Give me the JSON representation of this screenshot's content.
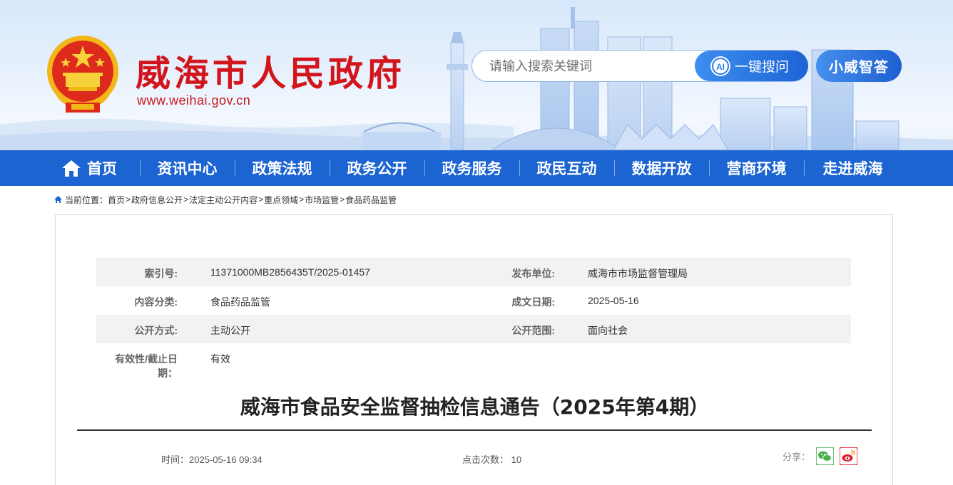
{
  "header": {
    "site_title": "威海市人民政府",
    "site_url": "www.weihai.gov.cn",
    "emblem_icon": "national-emblem-icon",
    "search": {
      "placeholder": "请输入搜索关键词"
    },
    "ai_button_label": "一键搜问",
    "ai_icon_text": "AI",
    "assistant_button_label": "小威智答"
  },
  "colors": {
    "brand_red": "#d2151c",
    "nav_blue": "#1c64d2",
    "accent_blue": "#3d8ef0"
  },
  "nav": {
    "items": [
      "首页",
      "资讯中心",
      "政策法规",
      "政务公开",
      "政务服务",
      "政民互动",
      "数据开放",
      "营商环境",
      "走进威海"
    ]
  },
  "breadcrumb": {
    "prefix": "当前位置：",
    "items": [
      "首页",
      "政府信息公开",
      "法定主动公开内容",
      "重点领域",
      "市场监管",
      "食品药品监管"
    ],
    "separator": ">"
  },
  "meta": {
    "index_label": "索引号:",
    "index_value": "11371000MB2856435T/2025-01457",
    "publisher_label": "发布单位:",
    "publisher_value": "威海市市场监督管理局",
    "category_label": "内容分类:",
    "category_value": "食品药品监管",
    "date_label": "成文日期:",
    "date_value": "2025-05-16",
    "method_label": "公开方式:",
    "method_value": "主动公开",
    "scope_label": "公开范围:",
    "scope_value": "面向社会",
    "validity_label": "有效性/截止日期：",
    "validity_value": "有效"
  },
  "article": {
    "title": "威海市食品安全监督抽检信息通告（2025年第4期）",
    "time_label": "时间：",
    "time_value": "2025-05-16 09:34",
    "clicks_label": "点击次数：",
    "clicks_value": "10",
    "share_label": "分享："
  }
}
